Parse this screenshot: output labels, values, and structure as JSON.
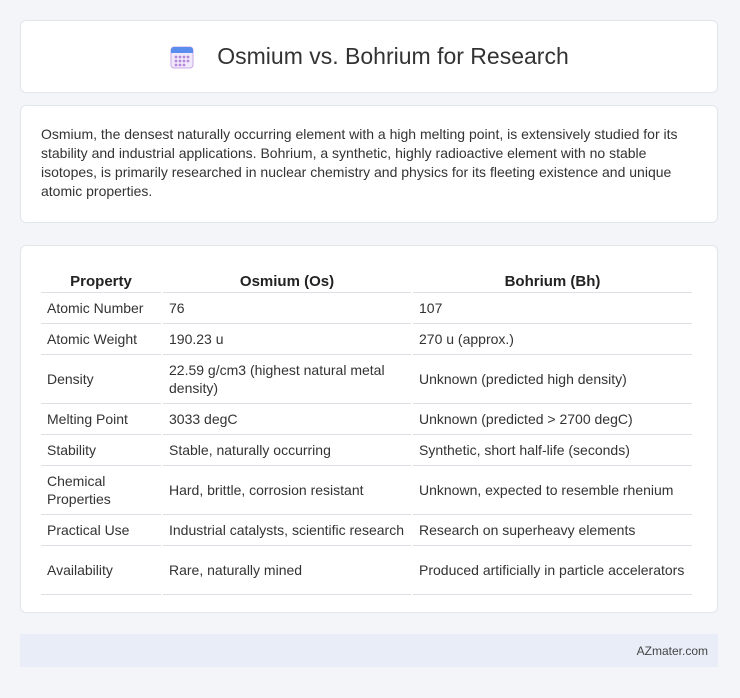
{
  "header": {
    "title": "Osmium vs. Bohrium for Research",
    "icon": "calendar-icon"
  },
  "description": "Osmium, the densest naturally occurring element with a high melting point, is extensively studied for its stability and industrial applications. Bohrium, a synthetic, highly radioactive element with no stable isotopes, is primarily researched in nuclear chemistry and physics for its fleeting existence and unique atomic properties.",
  "table": {
    "headers": [
      "Property",
      "Osmium (Os)",
      "Bohrium (Bh)"
    ],
    "rows": [
      [
        "Atomic Number",
        "76",
        "107"
      ],
      [
        "Atomic Weight",
        "190.23 u",
        "270 u (approx.)"
      ],
      [
        "Density",
        "22.59 g/cm3 (highest natural metal density)",
        "Unknown (predicted high density)"
      ],
      [
        "Melting Point",
        "3033 degC",
        "Unknown (predicted > 2700 degC)"
      ],
      [
        "Stability",
        "Stable, naturally occurring",
        "Synthetic, short half-life (seconds)"
      ],
      [
        "Chemical Properties",
        "Hard, brittle, corrosion resistant",
        "Unknown, expected to resemble rhenium"
      ],
      [
        "Practical Use",
        "Industrial catalysts, scientific research",
        "Research on superheavy elements"
      ],
      [
        "Availability",
        "Rare, naturally mined",
        "Produced artificially in particle accelerators"
      ]
    ]
  },
  "footer": {
    "text": "AZmater.com"
  },
  "colors": {
    "background": "#f3f5f9",
    "card": "#ffffff",
    "footer_bg": "#e8edf7",
    "icon_accent": "#5b8def",
    "icon_grid": "#c9a7e6"
  }
}
